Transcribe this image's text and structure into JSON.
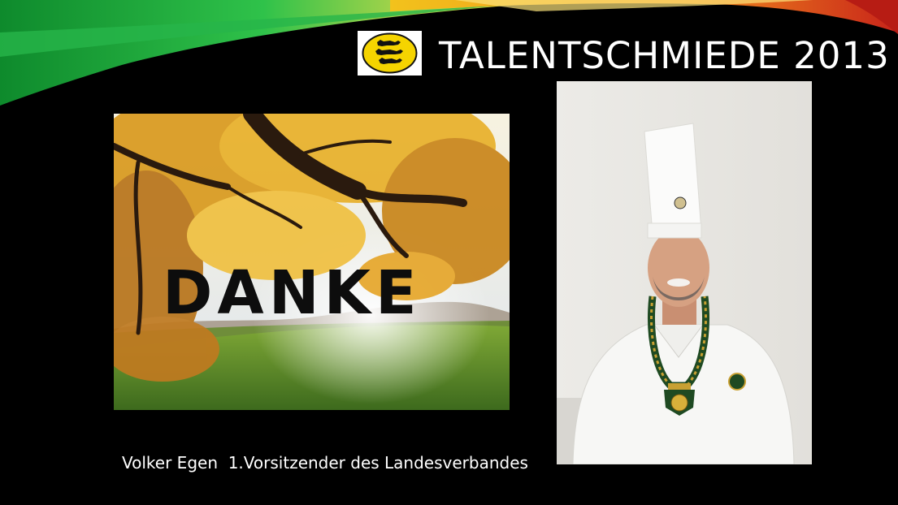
{
  "slide": {
    "title": "TALENTSCHMIEDE 2013",
    "logo_icon": "three-lions-coat-of-arms-icon",
    "colors": {
      "background": "#000000",
      "swoosh_green": "#1fa83a",
      "swoosh_yellow": "#f2c21c",
      "swoosh_red": "#c8241a",
      "logo_yellow": "#f5d400"
    }
  },
  "left_image": {
    "overlay_text": "DANKE"
  },
  "caption": {
    "text": "Volker Egen  1.Vorsitzender des Landesverbandes"
  }
}
